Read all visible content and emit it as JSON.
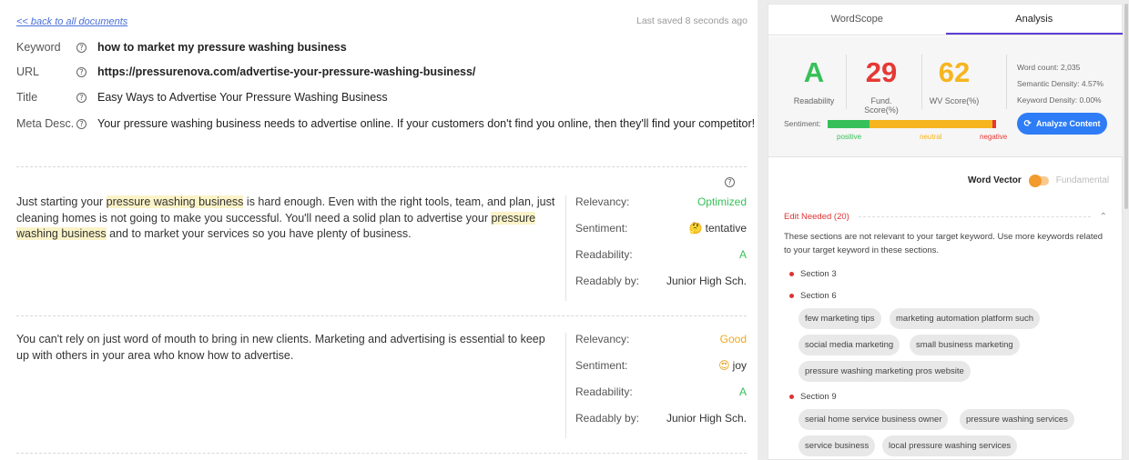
{
  "editor": {
    "back_link": "<< back to all documents",
    "last_saved": "Last saved 8 seconds ago",
    "meta": {
      "keyword_label": "Keyword",
      "keyword_value": "how to market my pressure washing business",
      "url_label": "URL",
      "url_value": "https://pressurenova.com/advertise-your-pressure-washing-business/",
      "title_label": "Title",
      "title_value": "Easy Ways to Advertise Your Pressure Washing Business",
      "desc_label": "Meta Desc.",
      "desc_value": "Your pressure washing business needs to advertise online. If your customers don't find you online, then they'll find your competitor!"
    },
    "help_glyph": "?",
    "paragraphs": [
      {
        "t1": "Just starting your ",
        "h1": "pressure washing business",
        "t2": " is hard enough. Even with the right tools, team, and plan, just cleaning homes is not going to make you successful. You'll need a solid plan to advertise your ",
        "h2": "pressure washing business",
        "t3": " and to market your services so you have plenty of business.",
        "relevancy_label": "Relevancy:",
        "relevancy": "Optimized",
        "sentiment_label": "Sentiment:",
        "sentiment_icon": "🤔",
        "sentiment": "tentative",
        "readability_label": "Readability:",
        "readability": "A",
        "readably_by_label": "Readably by:",
        "readably_by": "Junior High Sch."
      },
      {
        "text": "You can't rely on just word of mouth to bring in new clients. Marketing and advertising is essential to keep up with others in your area who know how to advertise.",
        "relevancy_label": "Relevancy:",
        "relevancy": "Good",
        "sentiment_label": "Sentiment:",
        "sentiment_icon": "😍",
        "sentiment": "joy",
        "readability_label": "Readability:",
        "readability": "A",
        "readably_by_label": "Readably by:",
        "readably_by": "Junior High Sch."
      }
    ]
  },
  "panel": {
    "tabs": [
      "WordScope",
      "Analysis"
    ],
    "active_tab": "Analysis",
    "scores": [
      {
        "value": "A",
        "label": "Readability",
        "color": "#37c05a"
      },
      {
        "value": "29",
        "label": "Fund. Score(%)",
        "color": "#e53935"
      },
      {
        "value": "62",
        "label": "WV Score(%)",
        "color": "#f6b51f"
      }
    ],
    "stats": {
      "word_count": "Word count: 2,035",
      "semantic_density": "Semantic Density: 4.57%",
      "keyword_density": "Keyword Density: 0.00%"
    },
    "sentiment_label": "Sentiment:",
    "sentiment_scale": [
      "positive",
      "neutral",
      "negative"
    ],
    "analyze_button": "Analyze Content",
    "analyze_icon": "refresh-icon",
    "toggle": {
      "on_label": "Word Vector",
      "off_label": "Fundamental"
    },
    "edit_needed": {
      "title": "Edit Needed (20)",
      "description": "These sections are not relevant to your target keyword. Use more keywords related to your target keyword in these sections.",
      "sections": [
        {
          "name": "Section 3",
          "keywords": []
        },
        {
          "name": "Section 6",
          "keywords": [
            "few marketing tips",
            "marketing automation platform such",
            "social media marketing",
            "small business marketing",
            "pressure washing marketing pros website"
          ]
        },
        {
          "name": "Section 9",
          "keywords": [
            "serial home service business owner",
            "pressure washing services",
            "service business",
            "local pressure washing services"
          ]
        }
      ]
    },
    "colors": {
      "accent": "#5b3ed6",
      "button": "#2e7cf6",
      "positive": "#37c05a",
      "neutral": "#f6b51f",
      "negative": "#e53935"
    }
  }
}
